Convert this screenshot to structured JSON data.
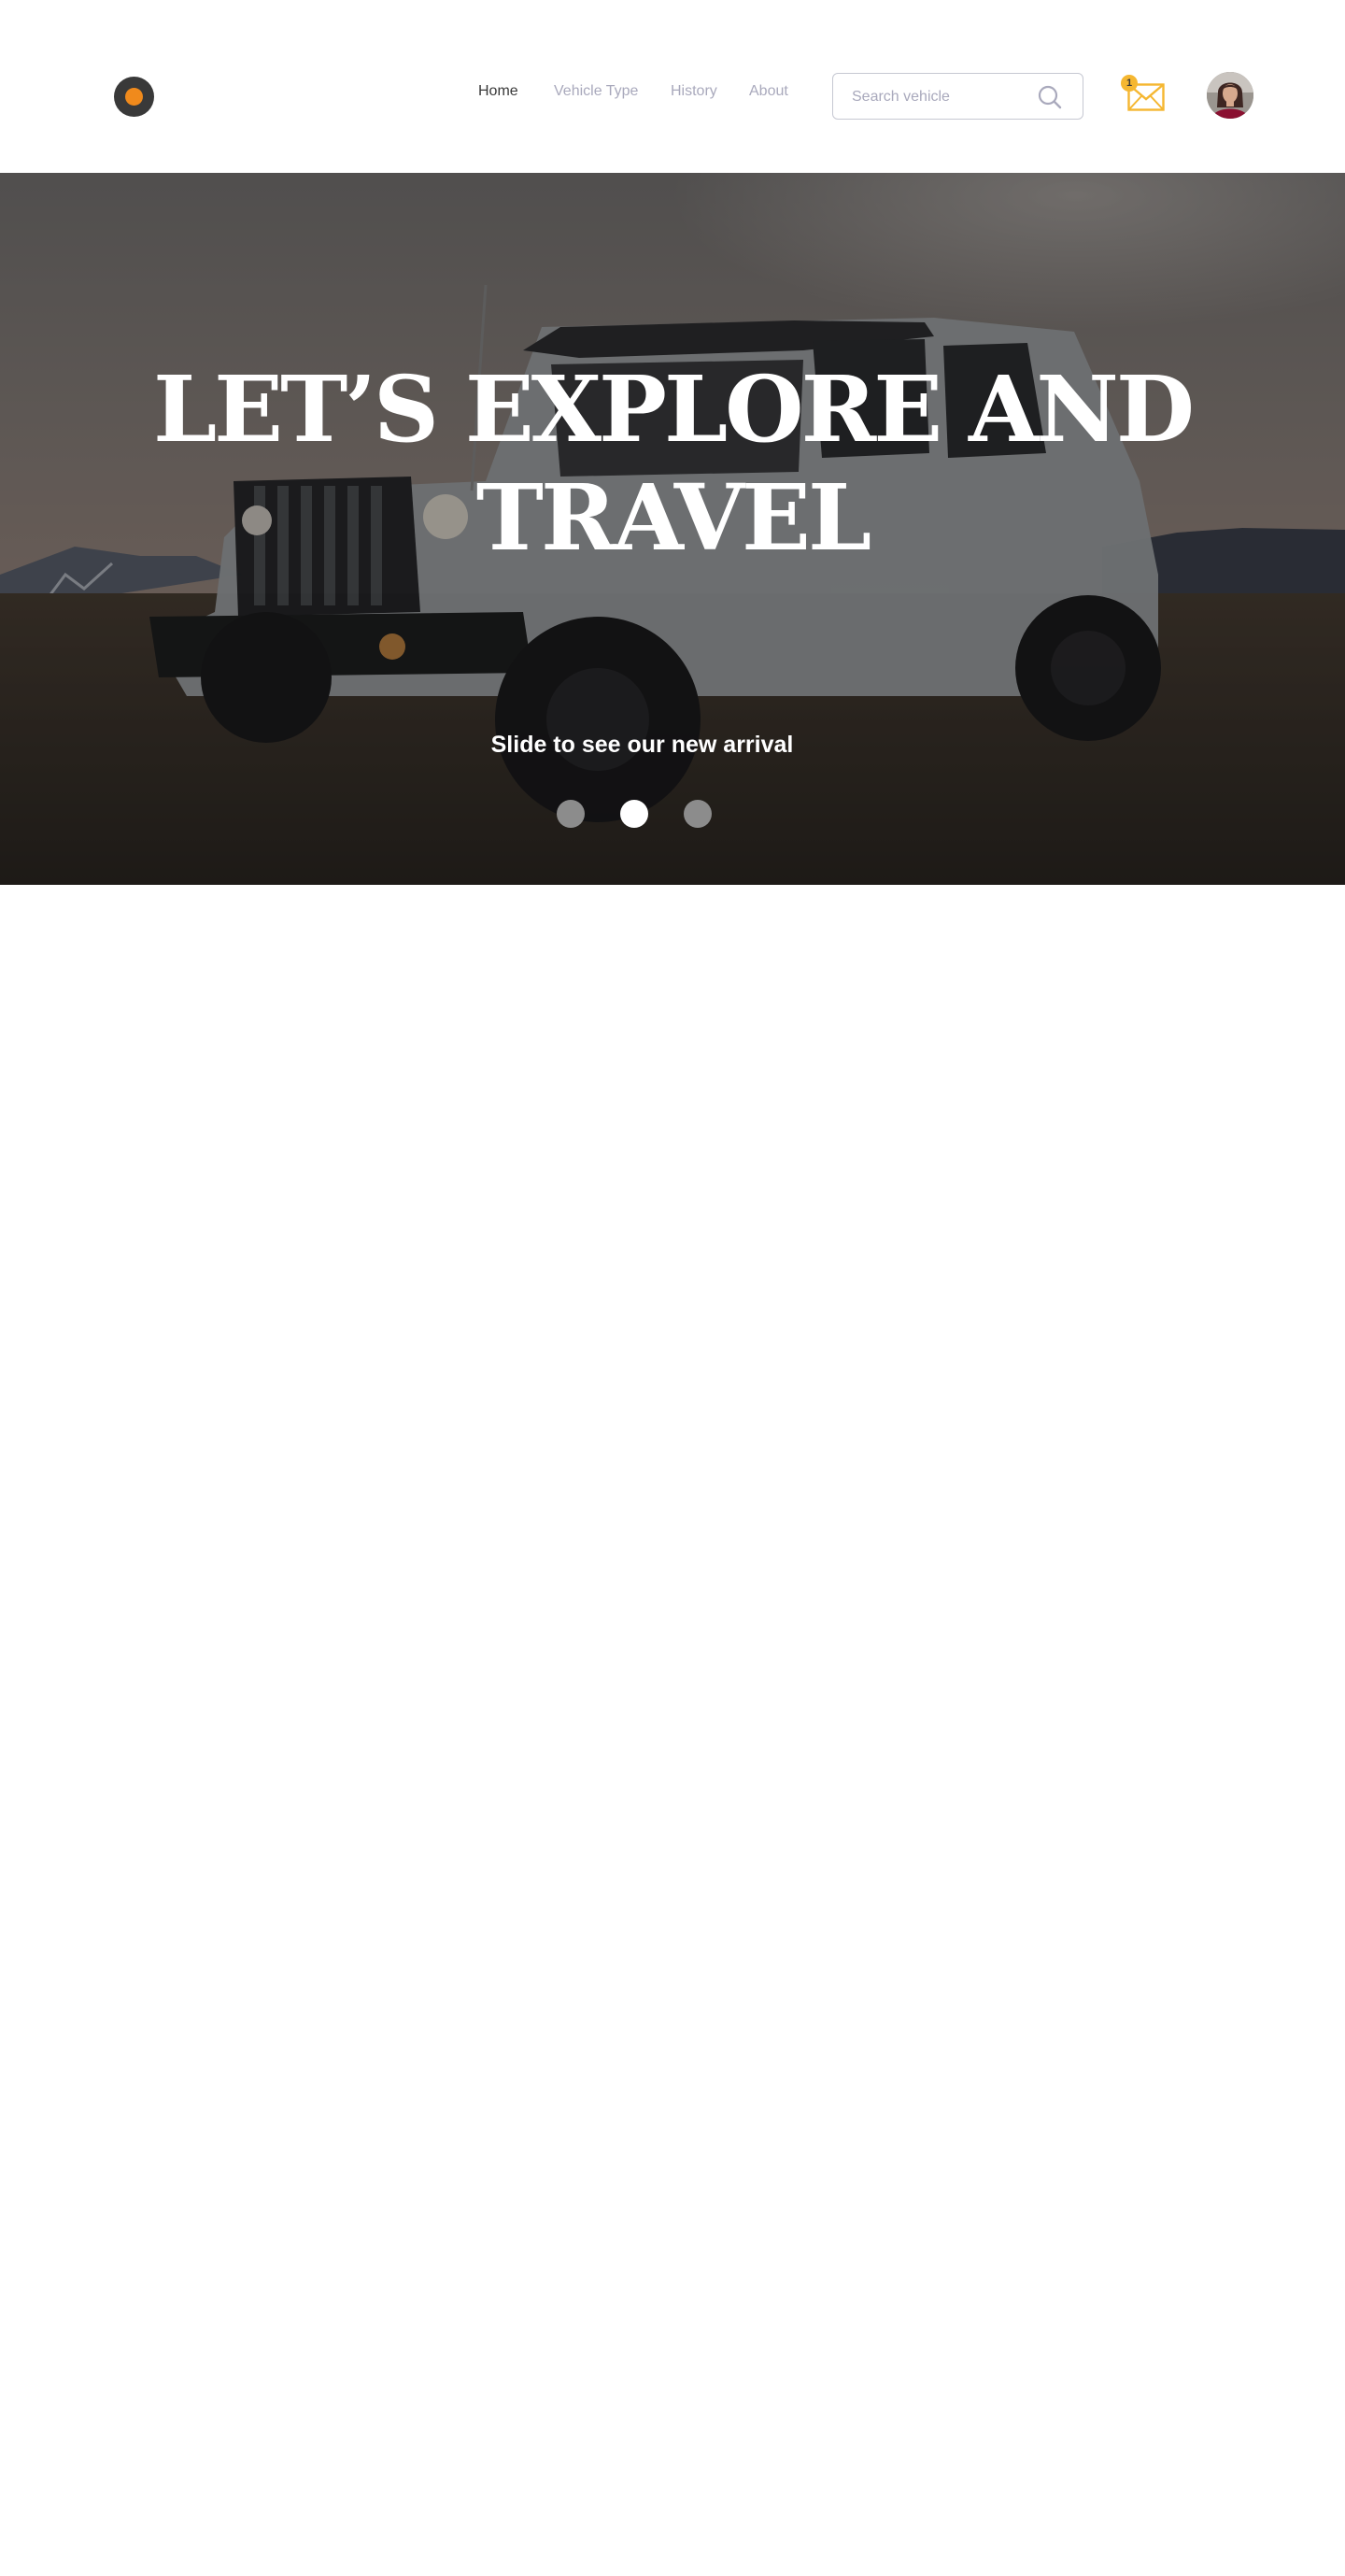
{
  "nav": {
    "items": [
      {
        "label": "Home",
        "active": true
      },
      {
        "label": "Vehicle Type",
        "active": false
      },
      {
        "label": "History",
        "active": false
      },
      {
        "label": "About",
        "active": false
      }
    ]
  },
  "search": {
    "placeholder": "Search vehicle",
    "value": "",
    "icon": "search-icon"
  },
  "notifications": {
    "icon": "mail-icon",
    "count": "1"
  },
  "hero": {
    "title": "LET’S EXPLORE AND TRAVEL",
    "subtitle": "Slide to see our new arrival",
    "slides": {
      "count": 3,
      "active_index": 1
    }
  },
  "colors": {
    "accent": "#f08a1c",
    "badge": "#f5b731",
    "text_dark": "#393939",
    "text_muted": "#a9a9bc",
    "dot_inactive": "#8c8c8c",
    "dot_active": "#ffffff"
  }
}
